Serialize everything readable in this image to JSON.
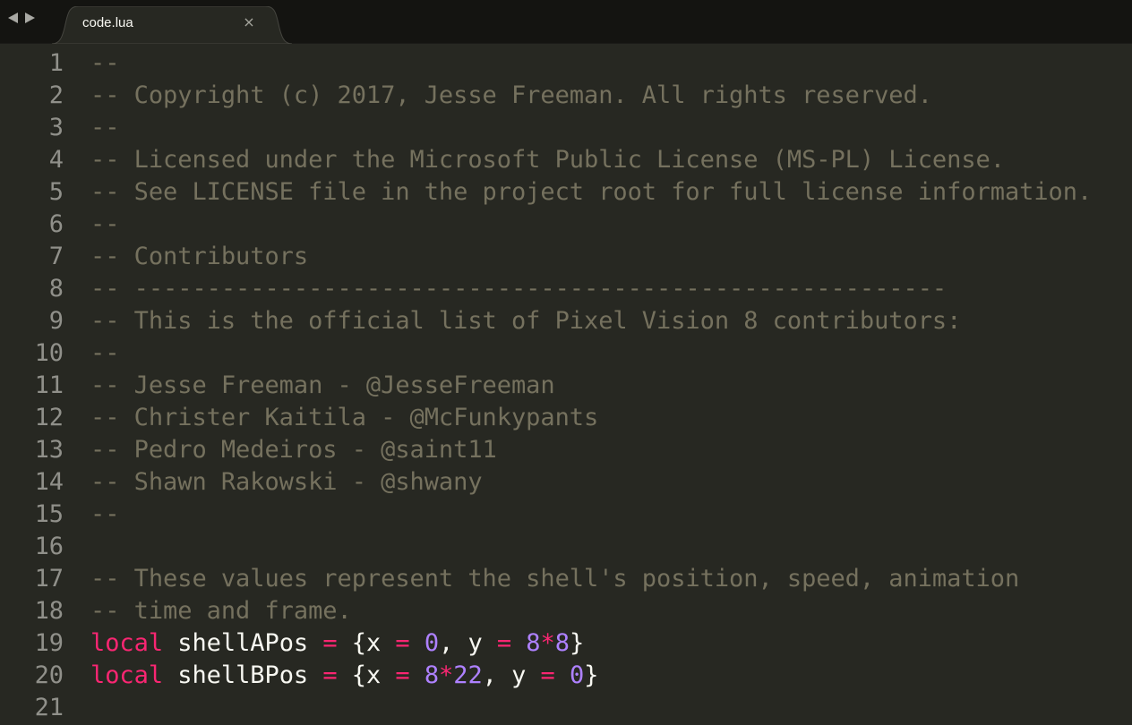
{
  "window": {
    "tab": {
      "title": "code.lua",
      "close_glyph": "×"
    },
    "nav": [
      "arrow-left-icon",
      "arrow-right-icon"
    ]
  },
  "theme": {
    "background": "#272822",
    "tabbar": "#141411",
    "comment": "#75715e",
    "keyword": "#f92672",
    "number": "#ae81ff",
    "text": "#f8f8f2",
    "gutter": "#90908a"
  },
  "editor": {
    "lines": [
      {
        "n": "1",
        "c": "--"
      },
      {
        "n": "2",
        "c": "-- Copyright (c) 2017, Jesse Freeman. All rights reserved."
      },
      {
        "n": "3",
        "c": "--"
      },
      {
        "n": "4",
        "c": "-- Licensed under the Microsoft Public License (MS-PL) License."
      },
      {
        "n": "5",
        "c": "-- See LICENSE file in the project root for full license information."
      },
      {
        "n": "6",
        "c": "--"
      },
      {
        "n": "7",
        "c": "-- Contributors"
      },
      {
        "n": "8",
        "c": "-- --------------------------------------------------------"
      },
      {
        "n": "9",
        "c": "-- This is the official list of Pixel Vision 8 contributors:"
      },
      {
        "n": "10",
        "c": "--"
      },
      {
        "n": "11",
        "c": "-- Jesse Freeman - @JesseFreeman"
      },
      {
        "n": "12",
        "c": "-- Christer Kaitila - @McFunkypants"
      },
      {
        "n": "13",
        "c": "-- Pedro Medeiros - @saint11"
      },
      {
        "n": "14",
        "c": "-- Shawn Rakowski - @shwany"
      },
      {
        "n": "15",
        "c": "--"
      },
      {
        "n": "16",
        "c": ""
      },
      {
        "n": "17",
        "c": "-- These values represent the shell's position, speed, animation"
      },
      {
        "n": "18",
        "c": "-- time and frame."
      },
      {
        "n": "19",
        "t": [
          "local",
          " ",
          "shellAPos",
          " ",
          "=",
          " {x ",
          "=",
          " ",
          "0",
          ", y ",
          "=",
          " ",
          "8",
          "*",
          "8",
          "}"
        ]
      },
      {
        "n": "20",
        "t": [
          "local",
          " ",
          "shellBPos",
          " ",
          "=",
          " {x ",
          "=",
          " ",
          "8",
          "*",
          "22",
          ", y ",
          "=",
          " ",
          "0",
          "}"
        ]
      },
      {
        "n": "21",
        "c": ""
      }
    ]
  }
}
